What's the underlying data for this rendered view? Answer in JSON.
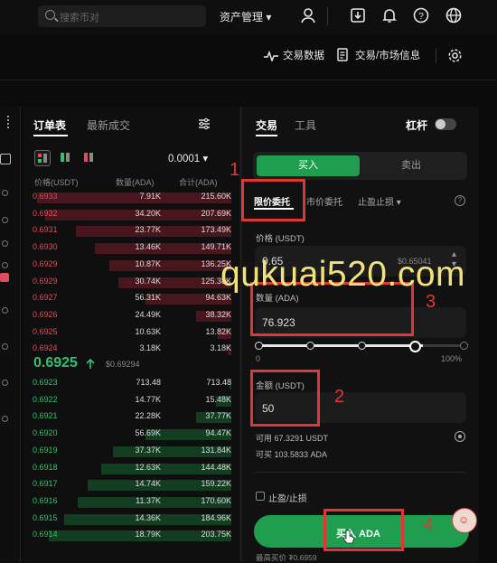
{
  "topbar": {
    "search_placeholder": "搜索币对",
    "asset_menu": "资产管理"
  },
  "subbar": {
    "trade_data": "交易数据",
    "trade_market": "交易/市场信息"
  },
  "orderbook": {
    "tabs": [
      "订单表",
      "最新成交"
    ],
    "precision": "0.0001",
    "headers": {
      "price": "价格(USDT)",
      "qty": "数量(ADA)",
      "total": "合计(ADA)"
    },
    "asks": [
      {
        "price": "0.6933",
        "qty": "7.91K",
        "total": "215.60K",
        "depth": 1.0
      },
      {
        "price": "0.6932",
        "qty": "34.20K",
        "total": "207.69K",
        "depth": 0.96
      },
      {
        "price": "0.6931",
        "qty": "23.77K",
        "total": "173.49K",
        "depth": 0.8
      },
      {
        "price": "0.6930",
        "qty": "13.46K",
        "total": "149.71K",
        "depth": 0.7
      },
      {
        "price": "0.6929",
        "qty": "10.87K",
        "total": "136.25K",
        "depth": 0.63
      },
      {
        "price": "0.6929",
        "qty": "30.74K",
        "total": "125.38K",
        "depth": 0.58
      },
      {
        "price": "0.6927",
        "qty": "56.31K",
        "total": "94.63K",
        "depth": 0.44
      },
      {
        "price": "0.6926",
        "qty": "24.49K",
        "total": "38.32K",
        "depth": 0.18
      },
      {
        "price": "0.6925",
        "qty": "10.63K",
        "total": "13.82K",
        "depth": 0.07
      },
      {
        "price": "0.6924",
        "qty": "3.18K",
        "total": "3.18K",
        "depth": 0.02
      }
    ],
    "mid_price": "0.6925",
    "mid_usd": "$0.69294",
    "bids": [
      {
        "price": "0.6923",
        "qty": "713.48",
        "total": "713.48",
        "depth": 0.01
      },
      {
        "price": "0.6922",
        "qty": "14.77K",
        "total": "15.48K",
        "depth": 0.08
      },
      {
        "price": "0.6921",
        "qty": "22.28K",
        "total": "37.77K",
        "depth": 0.18
      },
      {
        "price": "0.6920",
        "qty": "56.69K",
        "total": "94.47K",
        "depth": 0.44
      },
      {
        "price": "0.6919",
        "qty": "37.37K",
        "total": "131.84K",
        "depth": 0.61
      },
      {
        "price": "0.6918",
        "qty": "12.63K",
        "total": "144.48K",
        "depth": 0.67
      },
      {
        "price": "0.6917",
        "qty": "14.74K",
        "total": "159.22K",
        "depth": 0.74
      },
      {
        "price": "0.6916",
        "qty": "11.37K",
        "total": "170.60K",
        "depth": 0.79
      },
      {
        "price": "0.6915",
        "qty": "14.36K",
        "total": "184.96K",
        "depth": 0.86
      },
      {
        "price": "0.6914",
        "qty": "18.79K",
        "total": "203.75K",
        "depth": 0.94
      }
    ]
  },
  "trade": {
    "tabs": [
      "交易",
      "工具"
    ],
    "leverage_label": "杠杆",
    "buy_label": "买入",
    "sell_label": "卖出",
    "order_types": [
      "限价委托",
      "市价委托",
      "止盈止损"
    ],
    "price_label": "价格 (USDT)",
    "price_value": "0.65",
    "price_hint": "$0.65041",
    "qty_label": "数量 (ADA)",
    "qty_value": "76.923",
    "slider_min": "0",
    "slider_max": "100%",
    "slider_fraction": 0.8,
    "amount_label": "金额 (USDT)",
    "amount_value": "50",
    "available": "可用 67.3291 USDT",
    "can_buy": "可买 103.5833 ADA",
    "tpsl_label": "止盈/止损",
    "buy_button": "买入 ADA",
    "footer": "最高买价 ₮0.6959"
  },
  "annotations": {
    "n1": "1",
    "n2": "2",
    "n3": "3",
    "n4": "4",
    "watermark": "qukuai520.com"
  },
  "colors": {
    "buy": "#1f9e4f",
    "sell": "#e04b5d",
    "annotation": "#e23535",
    "watermark": "#f2e27a"
  }
}
